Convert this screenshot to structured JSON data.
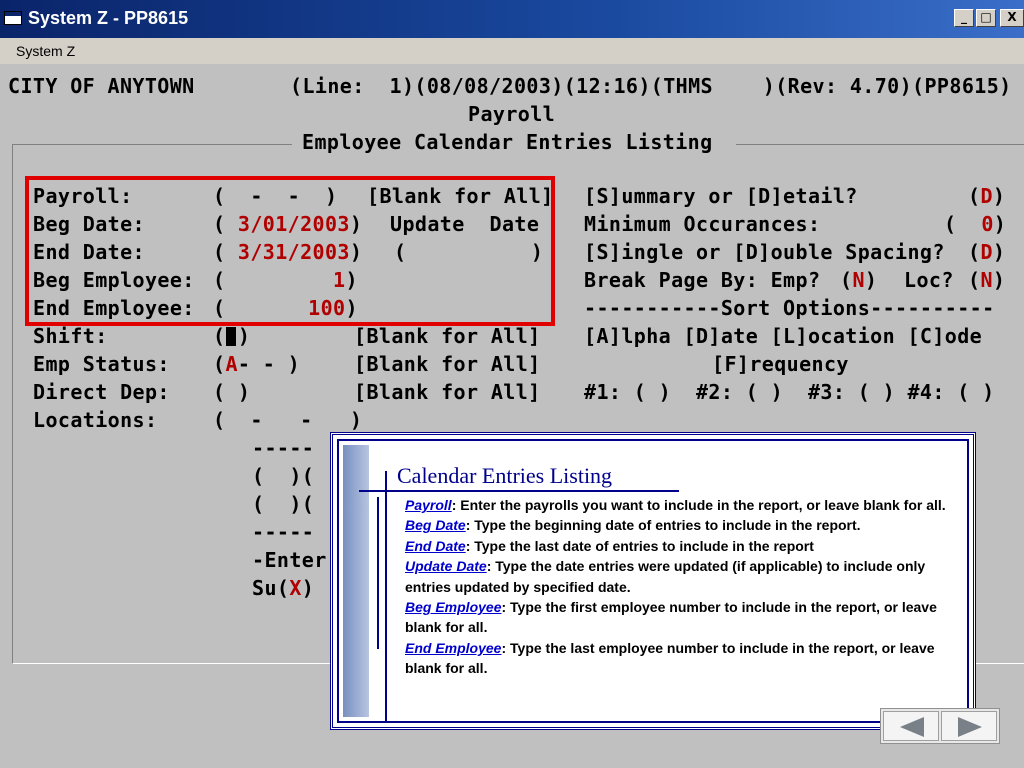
{
  "window": {
    "title": "System Z - PP8615",
    "minimize": "_",
    "maximize": "□",
    "close": "X"
  },
  "menu": {
    "label": "System Z"
  },
  "header": {
    "org": "CITY OF ANYTOWN",
    "status": "(Line:  1)(08/08/2003)(12:16)(THMS    )(Rev: 4.70)(PP8615)",
    "module": "Payroll",
    "screen_title": "Employee Calendar Entries Listing"
  },
  "left_fields": [
    {
      "label": "Payroll:",
      "value_text": "(  -  -  )",
      "note": "[Blank for All]"
    },
    {
      "label": "Beg Date:",
      "open": "( ",
      "value": "3/01/2003",
      "close": ")",
      "note": "Update  Date"
    },
    {
      "label": "End Date:",
      "open": "( ",
      "value": "3/31/2003",
      "close": ")",
      "note": "(          )"
    },
    {
      "label": "Beg Employee:",
      "open": "(",
      "value": "1",
      "close": ")"
    },
    {
      "label": "End Employee:",
      "open": "(",
      "value": "100",
      "close": ")"
    },
    {
      "label": "Shift:",
      "value_text": "( )",
      "note": "[Blank for All]"
    },
    {
      "label": "Emp Status:",
      "value": "A",
      "value_text": "- - )",
      "note": "[Blank for All]"
    },
    {
      "label": "Direct Dep:",
      "value_text": "( )",
      "note": "[Blank for All]"
    },
    {
      "label": "Locations:",
      "value_text": "(  -   -   )"
    }
  ],
  "right_fields": {
    "summary_label": "[S]ummary or [D]etail?",
    "summary_value": "D",
    "min_occ_label": "Minimum Occurances:",
    "min_occ_value": "0",
    "spacing_label": "[S]ingle or [D]ouble Spacing?",
    "spacing_value": "D",
    "break_label": "Break Page By: Emp?",
    "break_emp": "N",
    "break_loc_label": "Loc?",
    "break_loc": "N",
    "sort_header": "-----------Sort Options----------",
    "sort_line1": "[A]lpha [D]ate [L]ocation [C]ode",
    "sort_line2": "[F]requency",
    "sort_line3": "#1: ( )  #2: ( )  #3: ( ) #4: ( )"
  },
  "lower": {
    "dash1": "-----",
    "row1": "(  )(",
    "row2": "(  )(",
    "dash2": "-----",
    "enter": "-Enter",
    "su_prefix": "Su(",
    "su_value": "X",
    "su_suffix": ")"
  },
  "callout": {
    "title": "Calendar Entries Listing",
    "items": [
      {
        "term": "Payroll",
        "desc": ":  Enter the payrolls you want to include in the report, or leave blank for all."
      },
      {
        "term": "Beg Date",
        "desc": ":  Type the beginning date of entries to include in the report."
      },
      {
        "term": "End Date",
        "desc": ":  Type the last date of entries to include in the report"
      },
      {
        "term": "Update Date",
        "desc": ":  Type the date entries were updated (if applicable) to include only entries updated by specified date."
      },
      {
        "term": "Beg Employee",
        "desc": ":  Type the first employee number to include in the report, or leave blank for all."
      },
      {
        "term": "End Employee",
        "desc": ":  Type the last employee number to include in the report, or leave blank for all."
      }
    ]
  },
  "nav": {
    "prev": "previous-slide",
    "next": "next-slide"
  },
  "colors": {
    "highlight_box": "#e00000",
    "callout_border": "#00008b",
    "link": "#0000cc",
    "field_value": "#b00000"
  }
}
